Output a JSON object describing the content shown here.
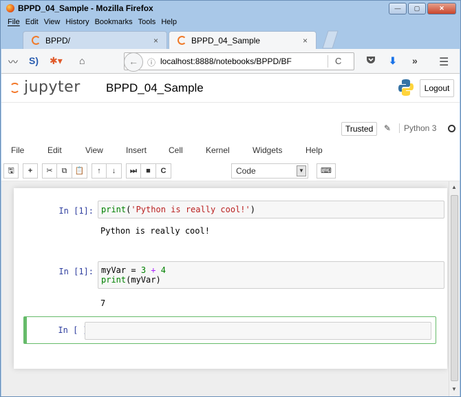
{
  "window": {
    "title": "BPPD_04_Sample - Mozilla Firefox",
    "minimize": "—",
    "maximize": "▢",
    "close": "✕"
  },
  "menubar": [
    "File",
    "Edit",
    "View",
    "History",
    "Bookmarks",
    "Tools",
    "Help"
  ],
  "tabs": [
    {
      "label": "BPPD/",
      "close": "×"
    },
    {
      "label": "BPPD_04_Sample",
      "close": "×"
    }
  ],
  "newtab": "+",
  "nav": {
    "url": "localhost:8888/notebooks/BPPD/BF",
    "info_icon": "ⓘ",
    "reload_icon": "C"
  },
  "jupyter": {
    "logo_text": "jupyter",
    "notebook_name": "BPPD_04_Sample",
    "logout": "Logout",
    "trusted": "Trusted",
    "kernel": "Python 3",
    "menu": [
      "File",
      "Edit",
      "View",
      "Insert",
      "Cell",
      "Kernel",
      "Widgets",
      "Help"
    ],
    "cell_type": "Code"
  },
  "cells": [
    {
      "prompt": "In [1]:",
      "output": "Python is really cool!"
    },
    {
      "prompt": "In [1]:",
      "output": "7"
    },
    {
      "prompt": "In [ ]:",
      "output": ""
    }
  ],
  "code": {
    "c1_fn": "print",
    "c1_open": "(",
    "c1_str": "'Python is really cool!'",
    "c1_close": ")",
    "c2_var": "myVar",
    "c2_eq": " = ",
    "c2_a": "3",
    "c2_plus": " + ",
    "c2_b": "4",
    "c2_fn": "print",
    "c2_arg": "(myVar)"
  }
}
